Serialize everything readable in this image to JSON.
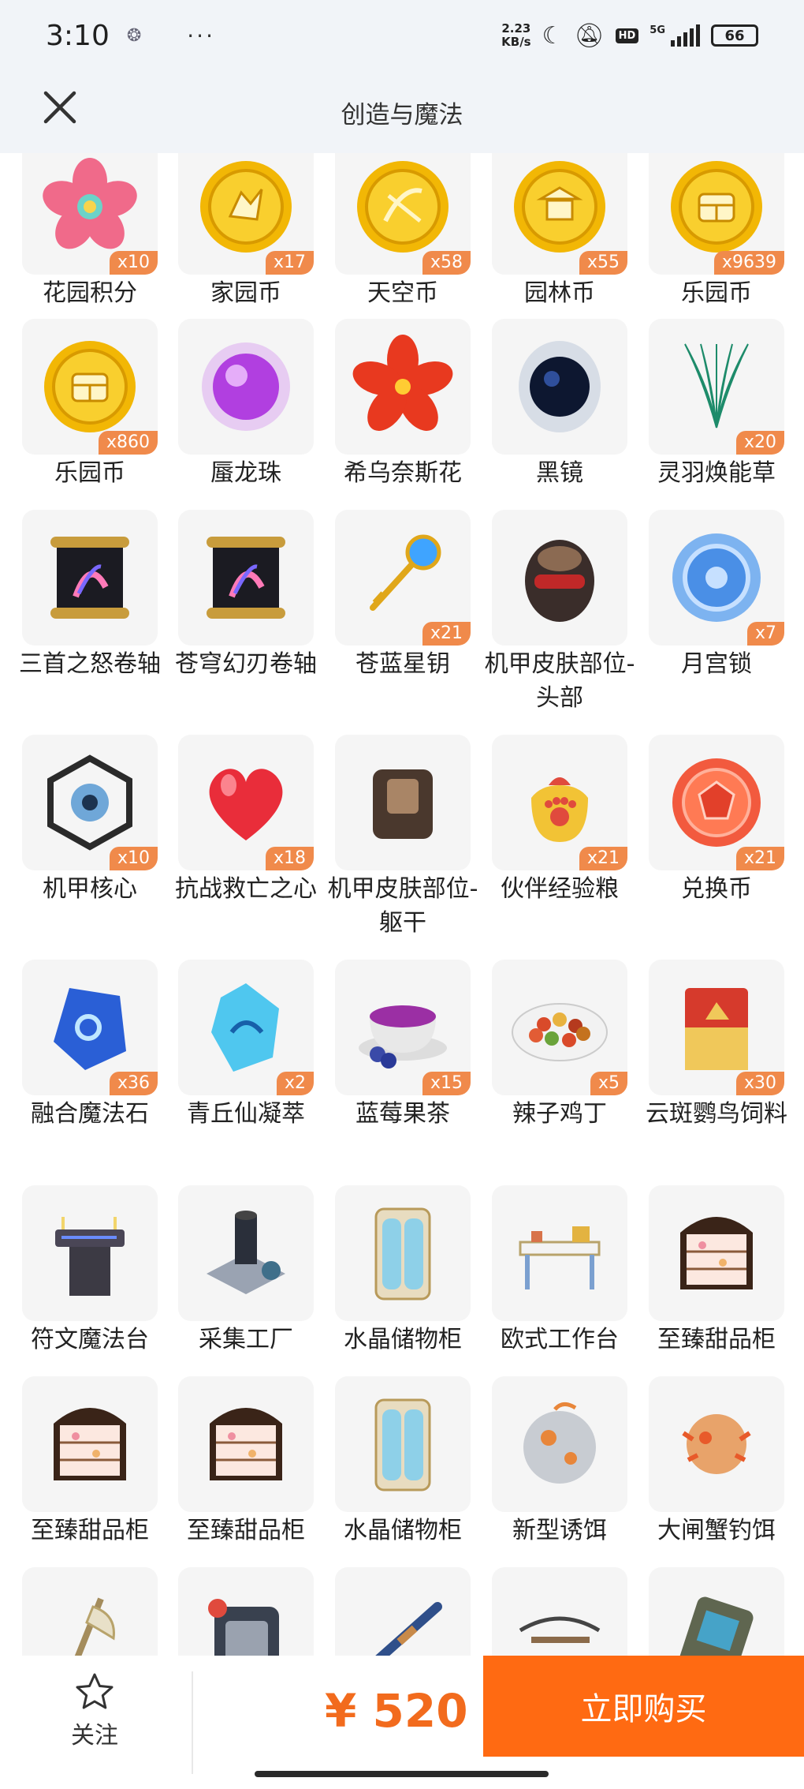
{
  "status": {
    "time": "3:10",
    "more": "···",
    "net_speed_value": "2.23",
    "net_speed_unit": "KB/s",
    "hd": "HD",
    "signal": "5G",
    "battery": "66"
  },
  "header": {
    "title": "创造与魔法"
  },
  "colors": {
    "accent": "#ff6a12",
    "badge": "#f08a4b",
    "price": "#f26b1d",
    "tile_bg": "#f5f5f5"
  },
  "items": [
    {
      "label": "花园积分",
      "qty": "x10",
      "icon": "pink-flower-badge-icon"
    },
    {
      "label": "家园币",
      "qty": "x17",
      "icon": "gold-coin-icon"
    },
    {
      "label": "天空币",
      "qty": "x58",
      "icon": "gold-coin-bow-icon"
    },
    {
      "label": "园林币",
      "qty": "x55",
      "icon": "gold-coin-pavilion-icon"
    },
    {
      "label": "乐园币",
      "qty": "x9639",
      "icon": "gold-coin-chest-icon"
    },
    {
      "label": "乐园币",
      "qty": "x860",
      "icon": "gold-coin-chest-icon"
    },
    {
      "label": "蜃龙珠",
      "qty": "",
      "icon": "purple-orb-icon"
    },
    {
      "label": "希乌奈斯花",
      "qty": "",
      "icon": "red-flower-icon"
    },
    {
      "label": "黑镜",
      "qty": "",
      "icon": "black-mirror-icon"
    },
    {
      "label": "灵羽焕能草",
      "qty": "x20",
      "icon": "green-grass-icon"
    },
    {
      "label": "三首之怒卷轴",
      "qty": "",
      "icon": "scroll-icon"
    },
    {
      "label": "苍穹幻刃卷轴",
      "qty": "",
      "icon": "scroll-icon"
    },
    {
      "label": "苍蓝星钥",
      "qty": "x21",
      "icon": "blue-star-key-icon"
    },
    {
      "label": "机甲皮肤部位-头部",
      "qty": "",
      "icon": "mech-head-icon"
    },
    {
      "label": "月宫锁",
      "qty": "x7",
      "icon": "blue-lock-icon"
    },
    {
      "label": "机甲核心",
      "qty": "x10",
      "icon": "mech-core-icon"
    },
    {
      "label": "抗战救亡之心",
      "qty": "x18",
      "icon": "red-heart-icon"
    },
    {
      "label": "机甲皮肤部位-躯干",
      "qty": "",
      "icon": "mech-torso-icon"
    },
    {
      "label": "伙伴经验粮",
      "qty": "x21",
      "icon": "paw-bag-icon"
    },
    {
      "label": "兑换币",
      "qty": "x21",
      "icon": "red-gem-coin-icon"
    },
    {
      "label": "融合魔法石",
      "qty": "x36",
      "icon": "blue-magic-stone-icon"
    },
    {
      "label": "青丘仙凝萃",
      "qty": "x2",
      "icon": "cyan-crystal-icon"
    },
    {
      "label": "蓝莓果茶",
      "qty": "x15",
      "icon": "berry-tea-icon"
    },
    {
      "label": "辣子鸡丁",
      "qty": "x5",
      "icon": "spicy-chicken-dish-icon"
    },
    {
      "label": "云斑鹦鸟饲料",
      "qty": "x30",
      "icon": "feed-bag-icon"
    },
    {
      "label": "符文魔法台",
      "qty": "",
      "icon": "rune-altar-icon"
    },
    {
      "label": "采集工厂",
      "qty": "",
      "icon": "factory-icon"
    },
    {
      "label": "水晶储物柜",
      "qty": "",
      "icon": "crystal-cabinet-icon"
    },
    {
      "label": "欧式工作台",
      "qty": "",
      "icon": "european-desk-icon"
    },
    {
      "label": "至臻甜品柜",
      "qty": "",
      "icon": "dessert-cabinet-icon"
    },
    {
      "label": "至臻甜品柜",
      "qty": "",
      "icon": "dessert-cabinet-icon"
    },
    {
      "label": "至臻甜品柜",
      "qty": "",
      "icon": "dessert-cabinet-icon"
    },
    {
      "label": "水晶储物柜",
      "qty": "",
      "icon": "crystal-cabinet-icon"
    },
    {
      "label": "新型诱饵",
      "qty": "",
      "icon": "bait-ball-icon"
    },
    {
      "label": "大闸蟹钓饵",
      "qty": "",
      "icon": "crab-bait-icon"
    },
    {
      "label": "",
      "qty": "",
      "icon": "axe-icon"
    },
    {
      "label": "",
      "qty": "",
      "icon": "pet-crate-icon"
    },
    {
      "label": "",
      "qty": "",
      "icon": "rifle-icon"
    },
    {
      "label": "",
      "qty": "",
      "icon": "crossbow-icon"
    },
    {
      "label": "",
      "qty": "",
      "icon": "device-icon"
    }
  ],
  "footer": {
    "follow_label": "关注",
    "price": "¥ 520",
    "buy_label": "立即购买"
  }
}
